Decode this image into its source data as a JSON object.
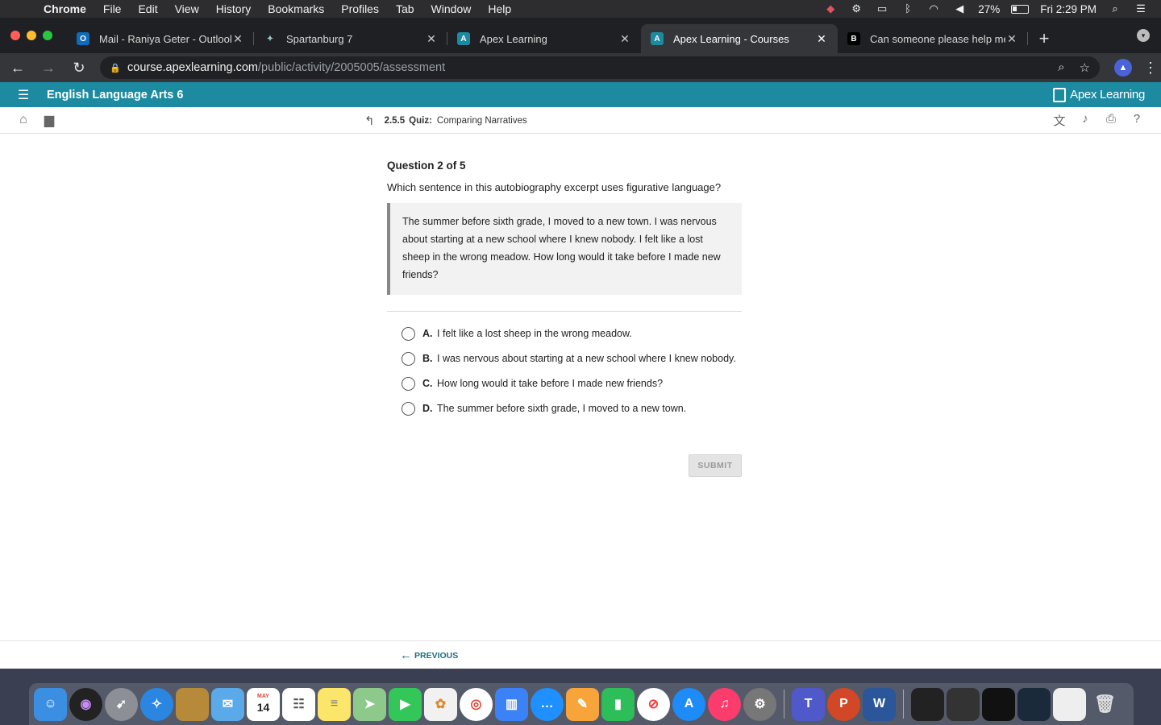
{
  "menubar": {
    "app": "Chrome",
    "items": [
      "File",
      "Edit",
      "View",
      "History",
      "Bookmarks",
      "Profiles",
      "Tab",
      "Window",
      "Help"
    ],
    "battery": "27%",
    "clock": "Fri 2:29 PM"
  },
  "tabs": [
    {
      "title": "Mail - Raniya Geter - Outlook",
      "fav_color": "#0f6cbd",
      "fav_glyph": "O"
    },
    {
      "title": "Spartanburg 7",
      "fav_color": "#2b2b2b",
      "fav_glyph": "✦"
    },
    {
      "title": "Apex Learning",
      "fav_color": "#1c8ba1",
      "fav_glyph": "A"
    },
    {
      "title": "Apex Learning - Courses",
      "fav_color": "#1c8ba1",
      "fav_glyph": "A"
    },
    {
      "title": "Can someone please help me ?",
      "fav_color": "#000000",
      "fav_glyph": "B"
    }
  ],
  "address": {
    "host": "course.apexlearning.com",
    "path": "/public/activity/2005005/assessment"
  },
  "apex": {
    "course_title": "English Language Arts 6",
    "logo_text": "Apex Learning",
    "activity_number": "2.5.5",
    "activity_type": "Quiz:",
    "activity_title": "Comparing Narratives"
  },
  "quiz": {
    "question_number": "Question 2 of 5",
    "question_text": "Which sentence in this autobiography excerpt uses figurative language?",
    "excerpt": "The summer before sixth grade, I moved to a new town. I was nervous about starting at a new school where I knew nobody. I felt like a lost sheep in the wrong meadow. How long would it take before I made new friends?",
    "options": [
      {
        "letter": "A.",
        "text": "I felt like a lost sheep in the wrong meadow."
      },
      {
        "letter": "B.",
        "text": "I was nervous about starting at a new school where I knew nobody."
      },
      {
        "letter": "C.",
        "text": "How long would it take before I made new friends?"
      },
      {
        "letter": "D.",
        "text": "The summer before sixth grade, I moved to a new town."
      }
    ],
    "submit_label": "SUBMIT",
    "previous_label": "PREVIOUS"
  },
  "colors": {
    "apex_teal": "#1c8ba1",
    "link": "#1b6f82"
  },
  "dock": {
    "calendar_month": "MAY",
    "calendar_day": "14"
  }
}
